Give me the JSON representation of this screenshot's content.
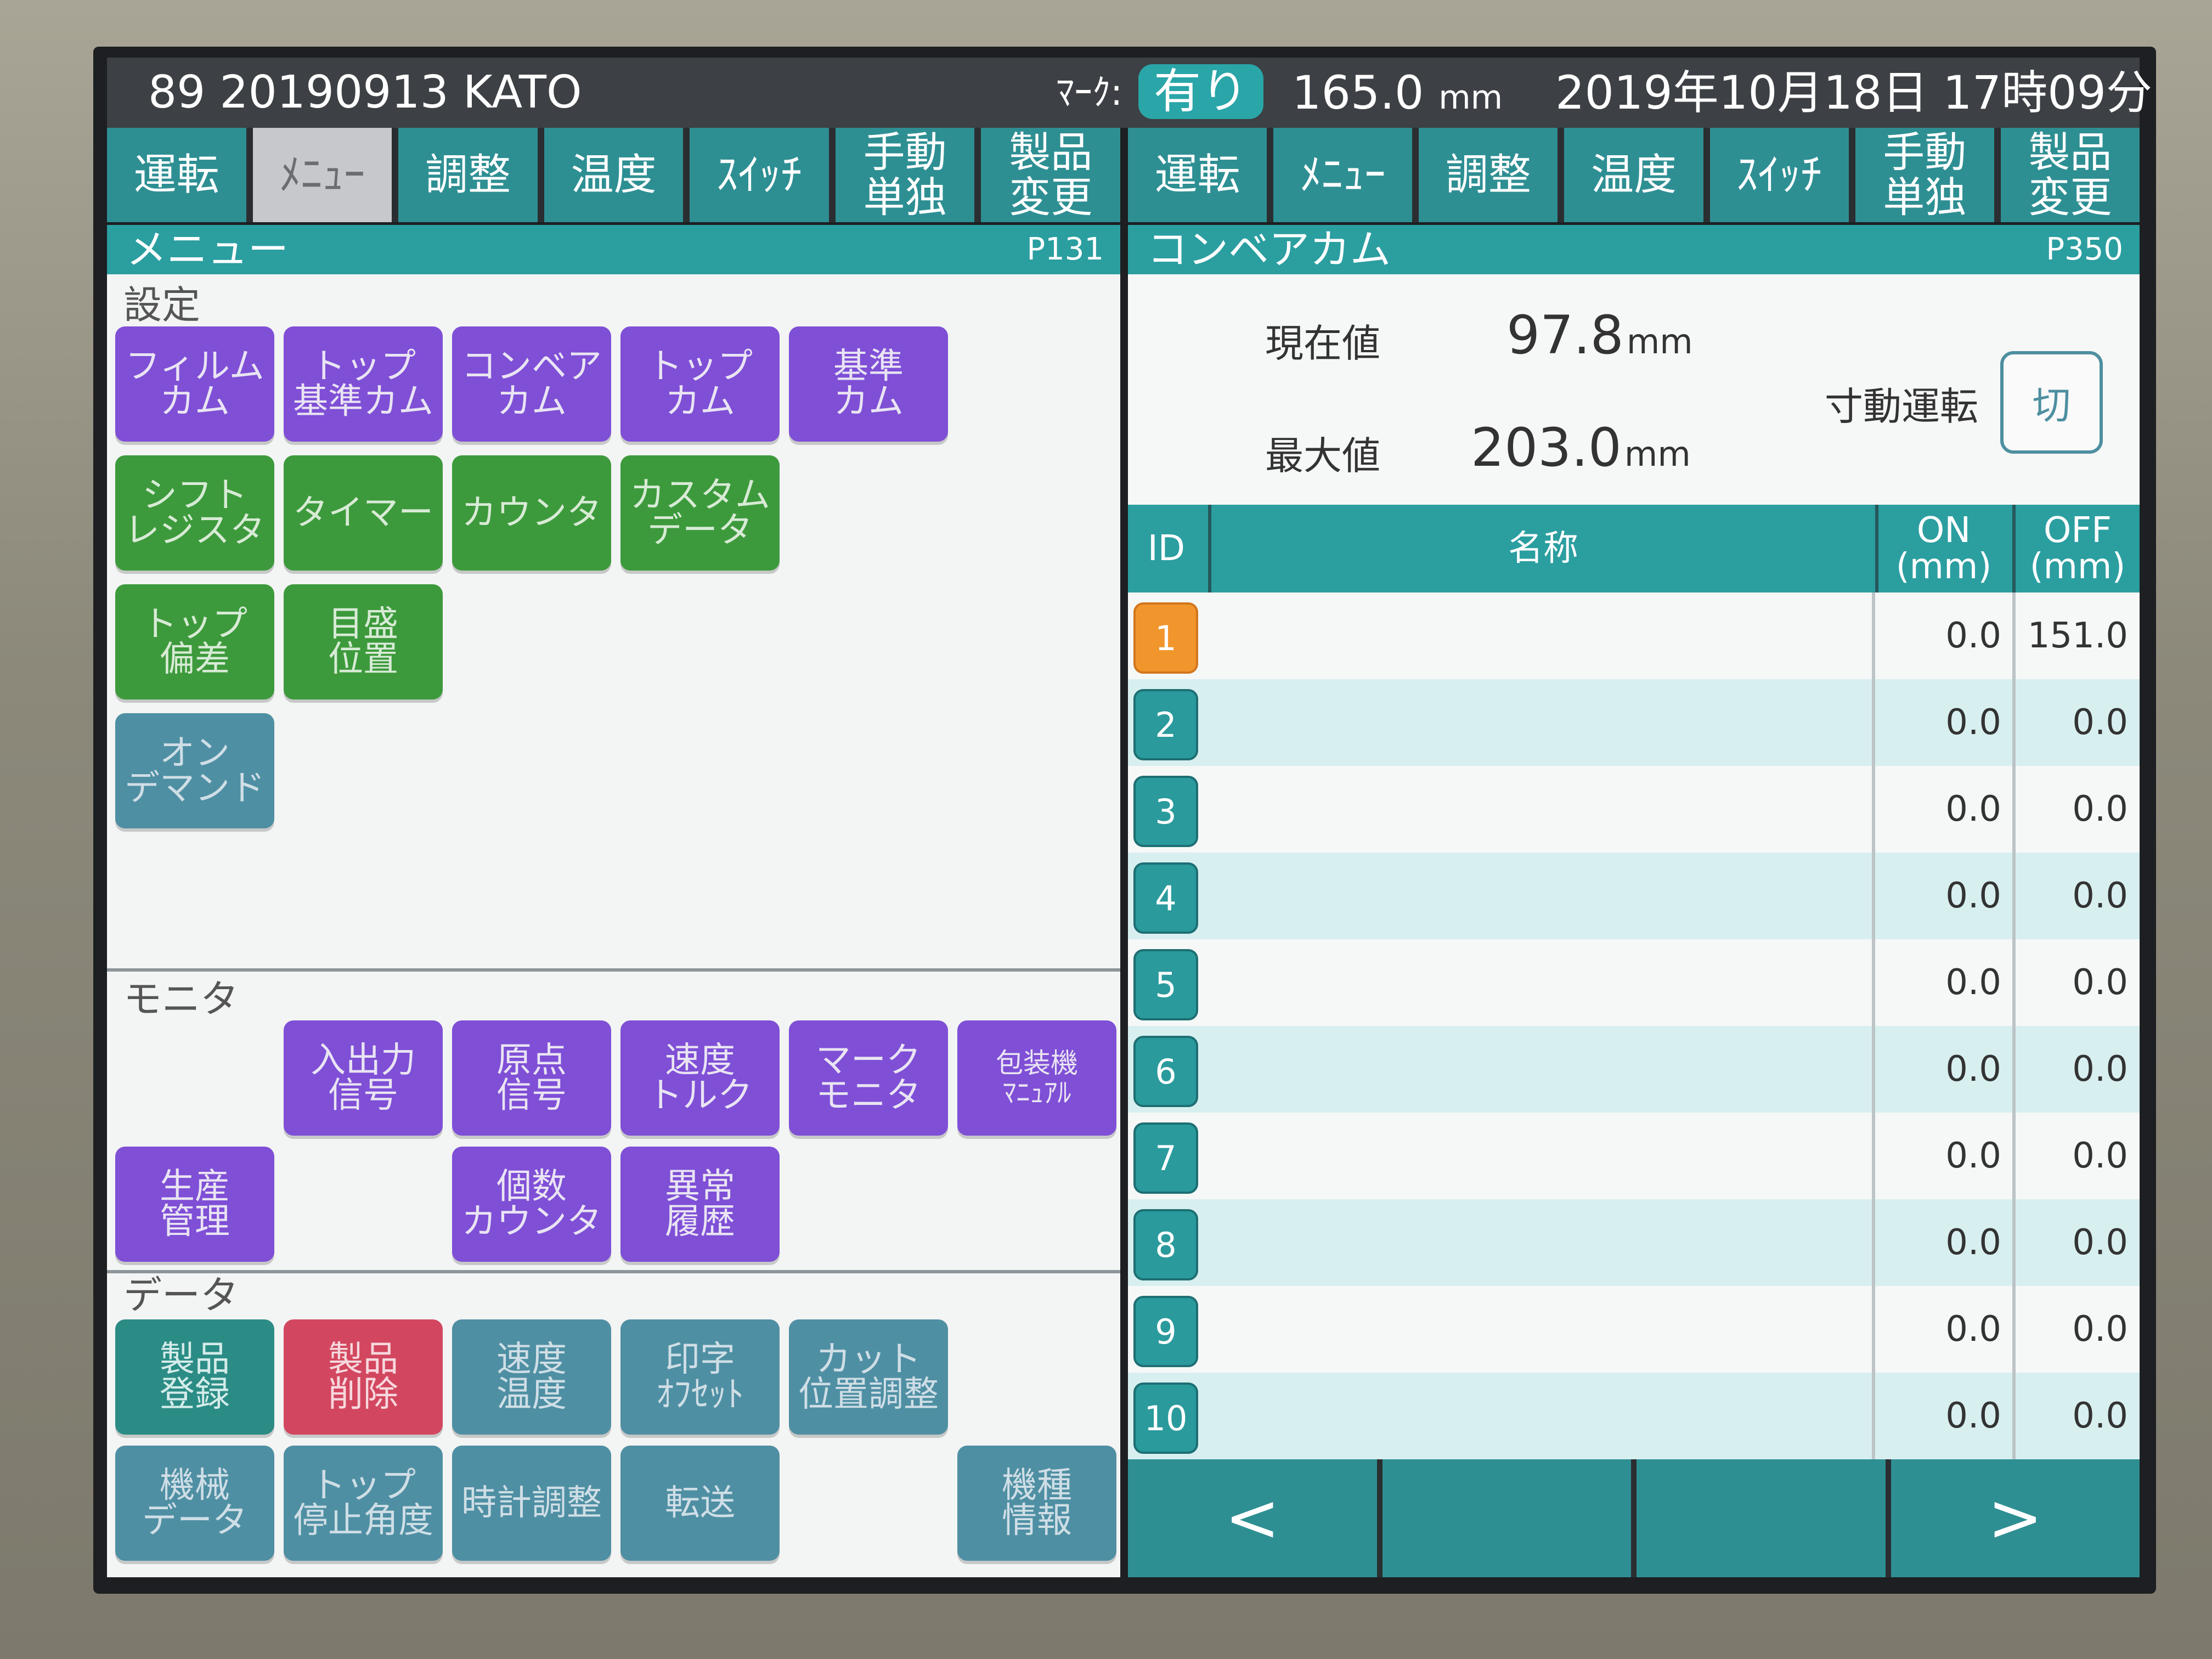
{
  "status_bar": {
    "product_id": "89  20190913 KATO",
    "mark_label": "ﾏｰｸ:",
    "mark_value": "有り",
    "length_value": "165.0",
    "length_unit": "mm",
    "datetime": "2019年10月18日 17時09分"
  },
  "tabs": [
    "運転",
    "ﾒﾆｭｰ",
    "調整",
    "温度",
    "ｽｲｯﾁ",
    "手動\n単独",
    "製品\n変更"
  ],
  "left_panel": {
    "title": "メニュー",
    "page": "P131",
    "sections": {
      "settings": "設定",
      "monitor": "モニタ",
      "data": "データ"
    },
    "buttons": {
      "film_cam": "フィルム\nカム",
      "top_ref_cam": "トップ\n基準カム",
      "conveyor_cam": "コンベア\nカム",
      "top_cam": "トップ\nカム",
      "ref_cam": "基準\nカム",
      "shift_register": "シフト\nレジスタ",
      "timer": "タイマー",
      "counter": "カウンタ",
      "custom_data": "カスタム\nデータ",
      "top_deviation": "トップ\n偏差",
      "scale_position": "目盛\n位置",
      "on_demand": "オン\nデマンド",
      "io_signal": "入出力\n信号",
      "origin_signal": "原点\n信号",
      "speed_torque": "速度\nトルク",
      "mark_monitor": "マーク\nモニタ",
      "packer_manual": "包装機\nﾏﾆｭｱﾙ",
      "production_mgmt": "生産\n管理",
      "piece_counter": "個数\nカウンタ",
      "error_history": "異常\n履歴",
      "product_register": "製品\n登録",
      "product_delete": "製品\n削除",
      "speed_temp": "速度\n温度",
      "print_offset": "印字\nｵﾌｾｯﾄ",
      "cut_position": "カット\n位置調整",
      "machine_data": "機械\nデータ",
      "top_stop_angle": "トップ\n停止角度",
      "clock_adjust": "時計調整",
      "transfer": "転送",
      "model_info": "機種\n情報"
    }
  },
  "right_panel": {
    "title": "コンベアカム",
    "page": "P350",
    "current_label": "現在値",
    "current_value": "97.8",
    "max_label": "最大値",
    "max_value": "203.0",
    "unit": "mm",
    "inching_label": "寸動運転",
    "inching_button": "切",
    "table": {
      "headers": {
        "id": "ID",
        "name": "名称",
        "on": "ON\n(mm)",
        "off": "OFF\n(mm)"
      },
      "rows": [
        {
          "id": "1",
          "name": "",
          "on": "0.0",
          "off": "151.0"
        },
        {
          "id": "2",
          "name": "",
          "on": "0.0",
          "off": "0.0"
        },
        {
          "id": "3",
          "name": "",
          "on": "0.0",
          "off": "0.0"
        },
        {
          "id": "4",
          "name": "",
          "on": "0.0",
          "off": "0.0"
        },
        {
          "id": "5",
          "name": "",
          "on": "0.0",
          "off": "0.0"
        },
        {
          "id": "6",
          "name": "",
          "on": "0.0",
          "off": "0.0"
        },
        {
          "id": "7",
          "name": "",
          "on": "0.0",
          "off": "0.0"
        },
        {
          "id": "8",
          "name": "",
          "on": "0.0",
          "off": "0.0"
        },
        {
          "id": "9",
          "name": "",
          "on": "0.0",
          "off": "0.0"
        },
        {
          "id": "10",
          "name": "",
          "on": "0.0",
          "off": "0.0"
        }
      ]
    },
    "nav": {
      "prev": "<",
      "next": ">"
    }
  },
  "colors": {
    "teal": "#2b9ea0",
    "purple": "#7f4fd6",
    "green": "#3d9a3c",
    "grey_blue": "#4f8fa3",
    "red": "#d2475f",
    "selected_id": "#f0962d"
  }
}
